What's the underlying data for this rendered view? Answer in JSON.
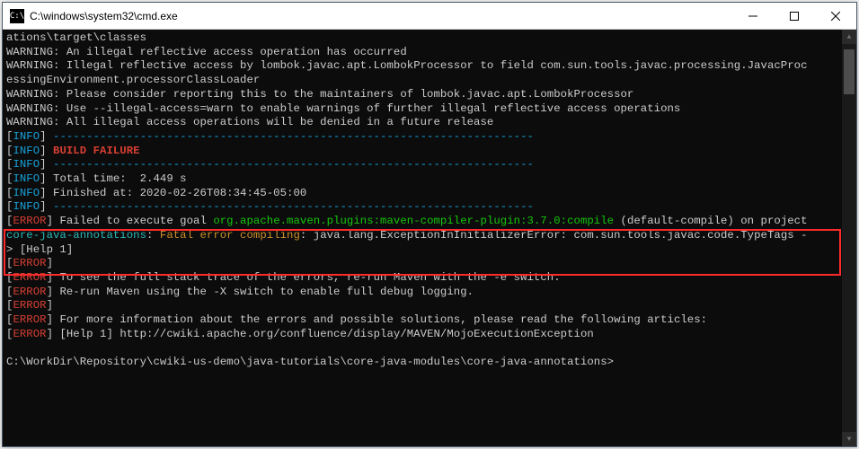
{
  "titlebar": {
    "icon_label": "C:\\",
    "title": "C:\\windows\\system32\\cmd.exe"
  },
  "lines": {
    "l0": "ations\\target\\classes",
    "l1": "WARNING: An illegal reflective access operation has occurred",
    "l2": "WARNING: Illegal reflective access by lombok.javac.apt.LombokProcessor to field com.sun.tools.javac.processing.JavacProc",
    "l3": "essingEnvironment.processorClassLoader",
    "l4": "WARNING: Please consider reporting this to the maintainers of lombok.javac.apt.LombokProcessor",
    "l5": "WARNING: Use --illegal-access=warn to enable warnings of further illegal reflective access operations",
    "l6": "WARNING: All illegal access operations will be denied in a future release",
    "lbr": "[",
    "rbr": "] ",
    "info": "INFO",
    "error": "ERROR",
    "dashes": "------------------------------------------------------------------------",
    "build_failure": "BUILD FAILURE",
    "total_time": "Total time:  2.449 s",
    "finished_at": "Finished at: 2020-02-26T08:34:45-05:00",
    "err_a1": "Failed to execute goal ",
    "err_a2": "org.apache.maven.plugins:maven-compiler-plugin:3.7.0:compile",
    "err_a3": " (default-compile) on project ",
    "err_a4": "core-java-annotations",
    "err_a5": ": ",
    "err_a6": "Fatal error compiling",
    "err_a7": ": java.lang.ExceptionInInitializerError: com.sun.tools.javac.code.TypeTags",
    "err_a8": " -",
    "err_a9": "> [Help 1]",
    "err_b1": "To see the full stack trace of the errors, re-run Maven with the -e switch.",
    "err_b2": "Re-run Maven using the -X switch to enable full debug logging.",
    "err_c1": "For more information about the errors and possible solutions, please read the following articles:",
    "err_c2": "[Help 1] http://cwiki.apache.org/confluence/display/MAVEN/MojoExecutionException",
    "prompt": "C:\\WorkDir\\Repository\\cwiki-us-demo\\java-tutorials\\core-java-modules\\core-java-annotations>"
  },
  "colors": {
    "info": "#17a0d8",
    "error": "#d83f33",
    "green": "#16c60c",
    "gold": "#cc8f2c",
    "cyan": "#2bb7b7"
  }
}
